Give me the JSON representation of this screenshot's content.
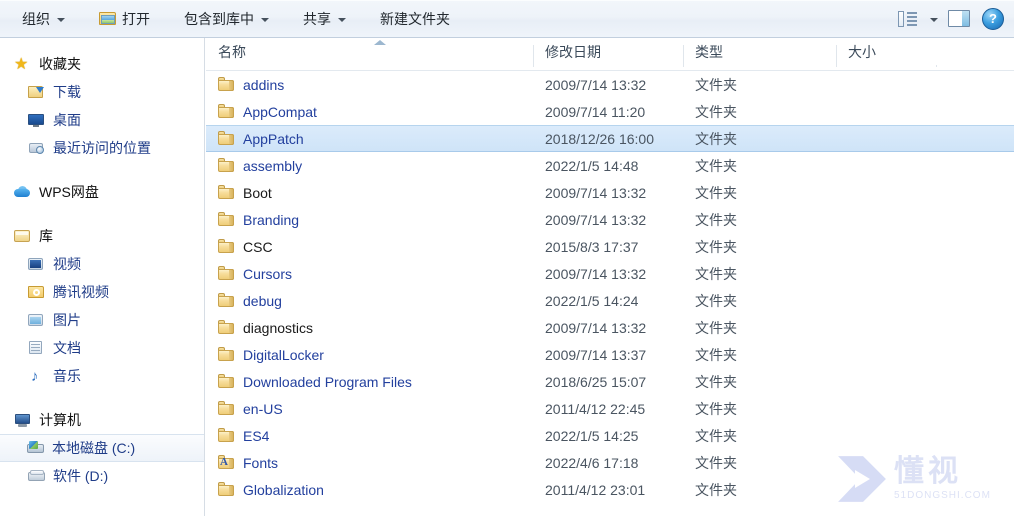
{
  "toolbar": {
    "organize_label": "组织",
    "open_label": "打开",
    "include_in_library_label": "包含到库中",
    "share_label": "共享",
    "new_folder_label": "新建文件夹",
    "view_icon": "view-list-icon",
    "view_caret_icon": "chevron-down-icon",
    "preview_pane_icon": "preview-pane-icon",
    "help_icon": "help-icon"
  },
  "sidebar": {
    "groups": [
      {
        "header": {
          "label": "收藏夹",
          "icon": "star-icon"
        },
        "items": [
          {
            "label": "下载",
            "icon": "downloads-folder-icon"
          },
          {
            "label": "桌面",
            "icon": "desktop-icon"
          },
          {
            "label": "最近访问的位置",
            "icon": "recent-places-icon"
          }
        ]
      },
      {
        "header": {
          "label": "WPS网盘",
          "icon": "cloud-icon"
        },
        "items": []
      },
      {
        "header": {
          "label": "库",
          "icon": "library-icon"
        },
        "items": [
          {
            "label": "视频",
            "icon": "video-library-icon"
          },
          {
            "label": "腾讯视频",
            "icon": "tencent-video-folder-icon"
          },
          {
            "label": "图片",
            "icon": "pictures-library-icon"
          },
          {
            "label": "文档",
            "icon": "documents-library-icon"
          },
          {
            "label": "音乐",
            "icon": "music-library-icon"
          }
        ]
      },
      {
        "header": {
          "label": "计算机",
          "icon": "computer-icon"
        },
        "items": [
          {
            "label": "本地磁盘 (C:)",
            "icon": "system-drive-icon",
            "selected": true
          },
          {
            "label": "软件 (D:)",
            "icon": "drive-icon",
            "selected": false
          }
        ]
      }
    ]
  },
  "file_list": {
    "columns": [
      {
        "key": "name",
        "label": "名称",
        "sorted": "asc"
      },
      {
        "key": "date",
        "label": "修改日期"
      },
      {
        "key": "type",
        "label": "类型"
      },
      {
        "key": "size",
        "label": "大小"
      }
    ],
    "rows": [
      {
        "name": "addins",
        "date": "2009/7/14 13:32",
        "type": "文件夹",
        "size": "",
        "icon": "folder-icon",
        "compressed": true,
        "selected": false
      },
      {
        "name": "AppCompat",
        "date": "2009/7/14 11:20",
        "type": "文件夹",
        "size": "",
        "icon": "folder-icon",
        "compressed": true,
        "selected": false
      },
      {
        "name": "AppPatch",
        "date": "2018/12/26 16:00",
        "type": "文件夹",
        "size": "",
        "icon": "folder-icon",
        "compressed": true,
        "selected": true
      },
      {
        "name": "assembly",
        "date": "2022/1/5 14:48",
        "type": "文件夹",
        "size": "",
        "icon": "folder-icon",
        "compressed": true,
        "selected": false
      },
      {
        "name": "Boot",
        "date": "2009/7/14 13:32",
        "type": "文件夹",
        "size": "",
        "icon": "folder-icon",
        "compressed": false,
        "selected": false
      },
      {
        "name": "Branding",
        "date": "2009/7/14 13:32",
        "type": "文件夹",
        "size": "",
        "icon": "folder-icon",
        "compressed": true,
        "selected": false
      },
      {
        "name": "CSC",
        "date": "2015/8/3 17:37",
        "type": "文件夹",
        "size": "",
        "icon": "folder-icon",
        "compressed": false,
        "selected": false
      },
      {
        "name": "Cursors",
        "date": "2009/7/14 13:32",
        "type": "文件夹",
        "size": "",
        "icon": "folder-icon",
        "compressed": true,
        "selected": false
      },
      {
        "name": "debug",
        "date": "2022/1/5 14:24",
        "type": "文件夹",
        "size": "",
        "icon": "folder-icon",
        "compressed": true,
        "selected": false
      },
      {
        "name": "diagnostics",
        "date": "2009/7/14 13:32",
        "type": "文件夹",
        "size": "",
        "icon": "folder-icon",
        "compressed": false,
        "selected": false
      },
      {
        "name": "DigitalLocker",
        "date": "2009/7/14 13:37",
        "type": "文件夹",
        "size": "",
        "icon": "folder-icon",
        "compressed": true,
        "selected": false
      },
      {
        "name": "Downloaded Program Files",
        "date": "2018/6/25 15:07",
        "type": "文件夹",
        "size": "",
        "icon": "folder-icon",
        "compressed": true,
        "selected": false
      },
      {
        "name": "en-US",
        "date": "2011/4/12 22:45",
        "type": "文件夹",
        "size": "",
        "icon": "folder-icon",
        "compressed": true,
        "selected": false
      },
      {
        "name": "ES4",
        "date": "2022/1/5 14:25",
        "type": "文件夹",
        "size": "",
        "icon": "folder-icon",
        "compressed": true,
        "selected": false
      },
      {
        "name": "Fonts",
        "date": "2022/4/6 17:18",
        "type": "文件夹",
        "size": "",
        "icon": "fonts-folder-icon",
        "compressed": true,
        "selected": false
      },
      {
        "name": "Globalization",
        "date": "2011/4/12 23:01",
        "type": "文件夹",
        "size": "",
        "icon": "folder-icon",
        "compressed": true,
        "selected": false
      }
    ]
  },
  "watermark": {
    "cn_text": "懂视",
    "en_text": "51DONGSHI.COM"
  }
}
